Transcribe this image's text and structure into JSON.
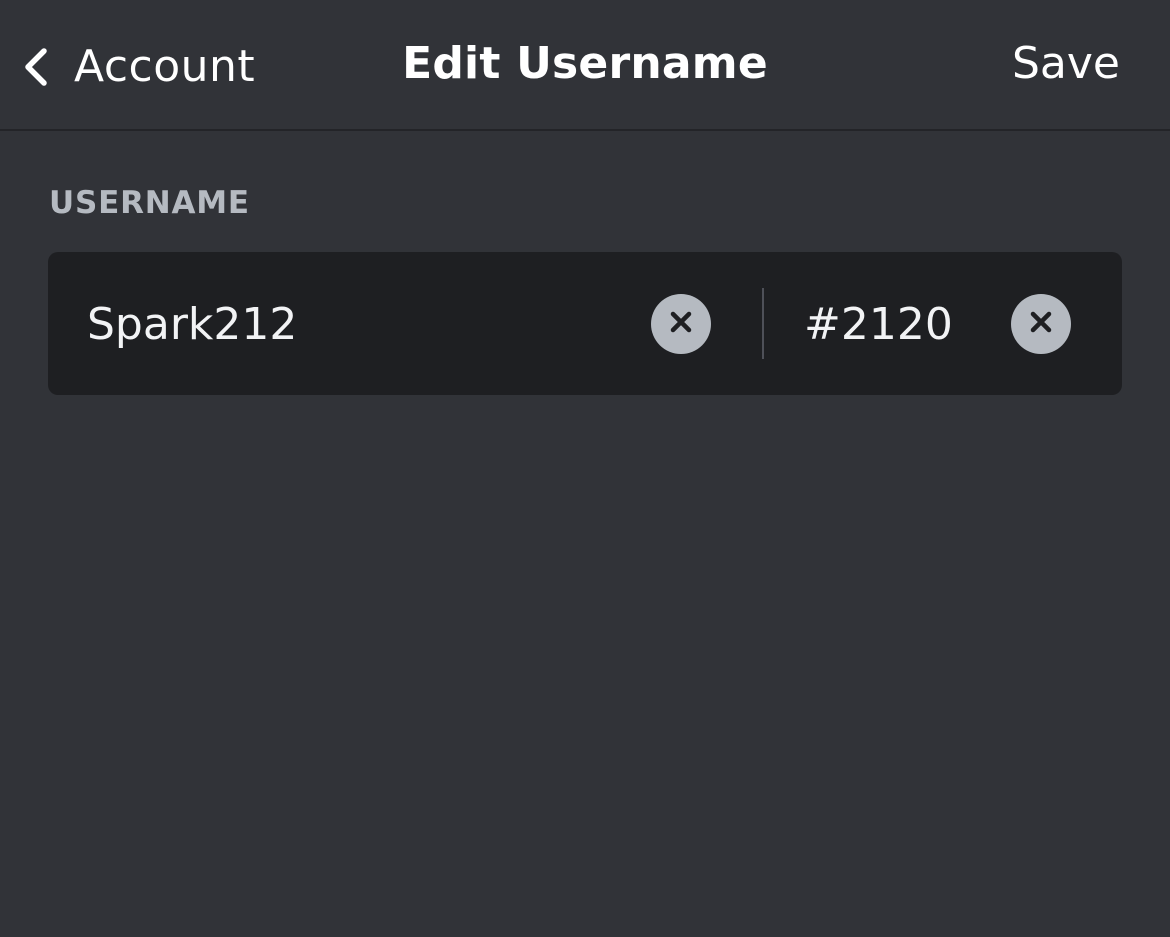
{
  "header": {
    "back_label": "Account",
    "title": "Edit Username",
    "save_label": "Save"
  },
  "form": {
    "section_label": "USERNAME",
    "username_value": "Spark212",
    "discriminator_value": "#2120"
  },
  "colors": {
    "background": "#313338",
    "input_background": "#1e1f22",
    "section_label": "#b5bac1",
    "clear_button": "#b5bac1"
  },
  "icons": {
    "back": "chevron-left-icon",
    "clear": "close-circle-icon"
  }
}
